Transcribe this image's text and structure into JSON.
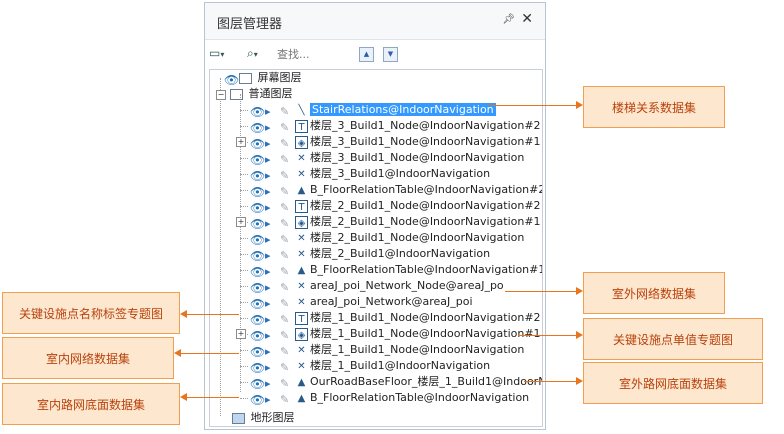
{
  "panel": {
    "title": "图层管理器",
    "pin_icon": "pin-icon",
    "close_icon": "close-icon"
  },
  "toolbar": {
    "search_placeholder": "查找..."
  },
  "tree": {
    "groups": [
      {
        "label": "屏幕图层"
      },
      {
        "label": "普通图层"
      },
      {
        "label": "地形图层"
      }
    ],
    "layers": [
      {
        "label": "StairRelations@IndoorNavigation",
        "icon": "line-icon"
      },
      {
        "label": "楼层_3_Build1_Node@IndoorNavigation#2",
        "icon": "label-icon"
      },
      {
        "label": "楼层_3_Build1_Node@IndoorNavigation#1",
        "icon": "unique-icon"
      },
      {
        "label": "楼层_3_Build1_Node@IndoorNavigation",
        "icon": "network-icon"
      },
      {
        "label": "楼层_3_Build1@IndoorNavigation",
        "icon": "network-icon"
      },
      {
        "label": "B_FloorRelationTable@IndoorNavigation#2",
        "icon": "region-icon"
      },
      {
        "label": "楼层_2_Build1_Node@IndoorNavigation#2",
        "icon": "label-icon"
      },
      {
        "label": "楼层_2_Build1_Node@IndoorNavigation#1",
        "icon": "unique-icon"
      },
      {
        "label": "楼层_2_Build1_Node@IndoorNavigation",
        "icon": "network-icon"
      },
      {
        "label": "楼层_2_Build1@IndoorNavigation",
        "icon": "network-icon"
      },
      {
        "label": "B_FloorRelationTable@IndoorNavigation#1",
        "icon": "region-icon"
      },
      {
        "label": "areaJ_poi_Network_Node@areaJ_po",
        "icon": "network-icon"
      },
      {
        "label": "areaJ_poi_Network@areaJ_poi",
        "icon": "network-icon"
      },
      {
        "label": "楼层_1_Build1_Node@IndoorNavigation#2",
        "icon": "label-icon"
      },
      {
        "label": "楼层_1_Build1_Node@IndoorNavigation#1",
        "icon": "unique-icon"
      },
      {
        "label": "楼层_1_Build1_Node@IndoorNavigation",
        "icon": "network-icon"
      },
      {
        "label": "楼层_1_Build1@IndoorNavigation",
        "icon": "network-icon"
      },
      {
        "label": "OurRoadBaseFloor_楼层_1_Build1@IndoorNa",
        "icon": "region-icon"
      },
      {
        "label": "B_FloorRelationTable@IndoorNavigation",
        "icon": "region-icon"
      }
    ]
  },
  "callouts": {
    "stair": "楼梯关系数据集",
    "outdoor_network": "室外网络数据集",
    "key_unique": "关键设施点单值专题图",
    "outdoor_road": "室外路网底面数据集",
    "key_label": "关键设施点名称标签专题图",
    "indoor_network": "室内网络数据集",
    "indoor_road": "室内路网底面数据集"
  },
  "colors": {
    "callout_bg": "#fde7cf",
    "callout_border": "#f0a050",
    "callout_text": "#b8420c",
    "selection": "#3399ff"
  }
}
